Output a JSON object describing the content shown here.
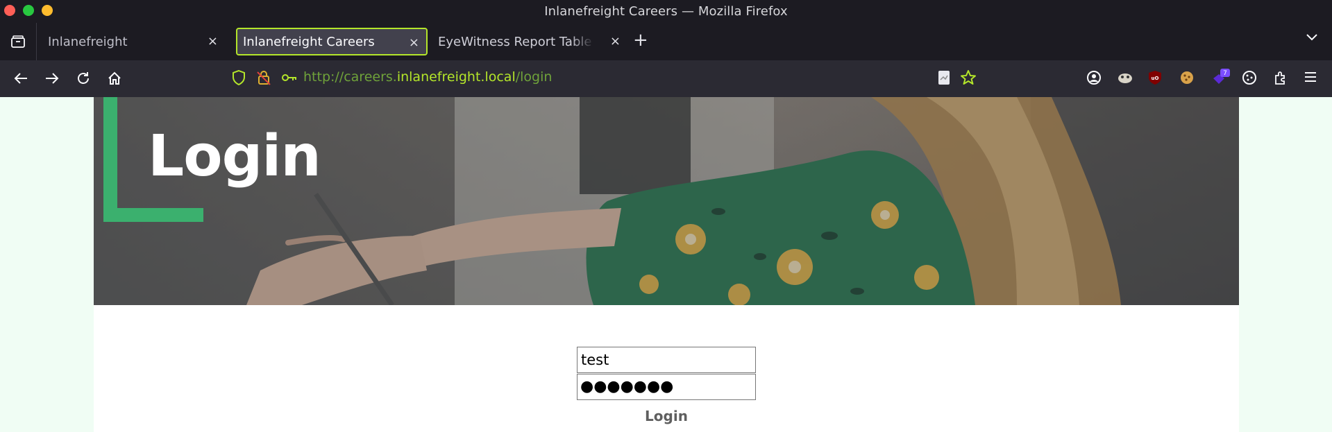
{
  "window": {
    "title": "Inlanefreight Careers — Mozilla Firefox"
  },
  "tabs": [
    {
      "label": "Inlanefreight",
      "close": "×"
    },
    {
      "label": "Inlanefreight Careers",
      "close": "×",
      "active": true
    },
    {
      "label": "EyeWitness Report Table of Contents",
      "close": "×"
    }
  ],
  "toolbar": {
    "new_tab": "+",
    "url_prefix": "http://careers.",
    "url_host": "inlanefreight.local",
    "url_path": "/login"
  },
  "extensions": {
    "badge_count": "7"
  },
  "page": {
    "hero_title": "Login",
    "username_value": "test",
    "password_mask": "●●●●●●●",
    "login_button": "Login"
  },
  "colors": {
    "accent_green": "#b4e62a",
    "hero_corner": "#3bb06e",
    "page_bg": "#f0fdf4"
  },
  "icons": [
    "tab-overview-icon",
    "back-icon",
    "forward-icon",
    "reload-icon",
    "home-icon",
    "shield-icon",
    "lock-icon",
    "key-icon",
    "reader-view-icon",
    "bookmark-star-icon",
    "account-icon",
    "extension-icons",
    "cookie-icon",
    "extensions-icon",
    "menu-icon",
    "tab-list-icon"
  ]
}
